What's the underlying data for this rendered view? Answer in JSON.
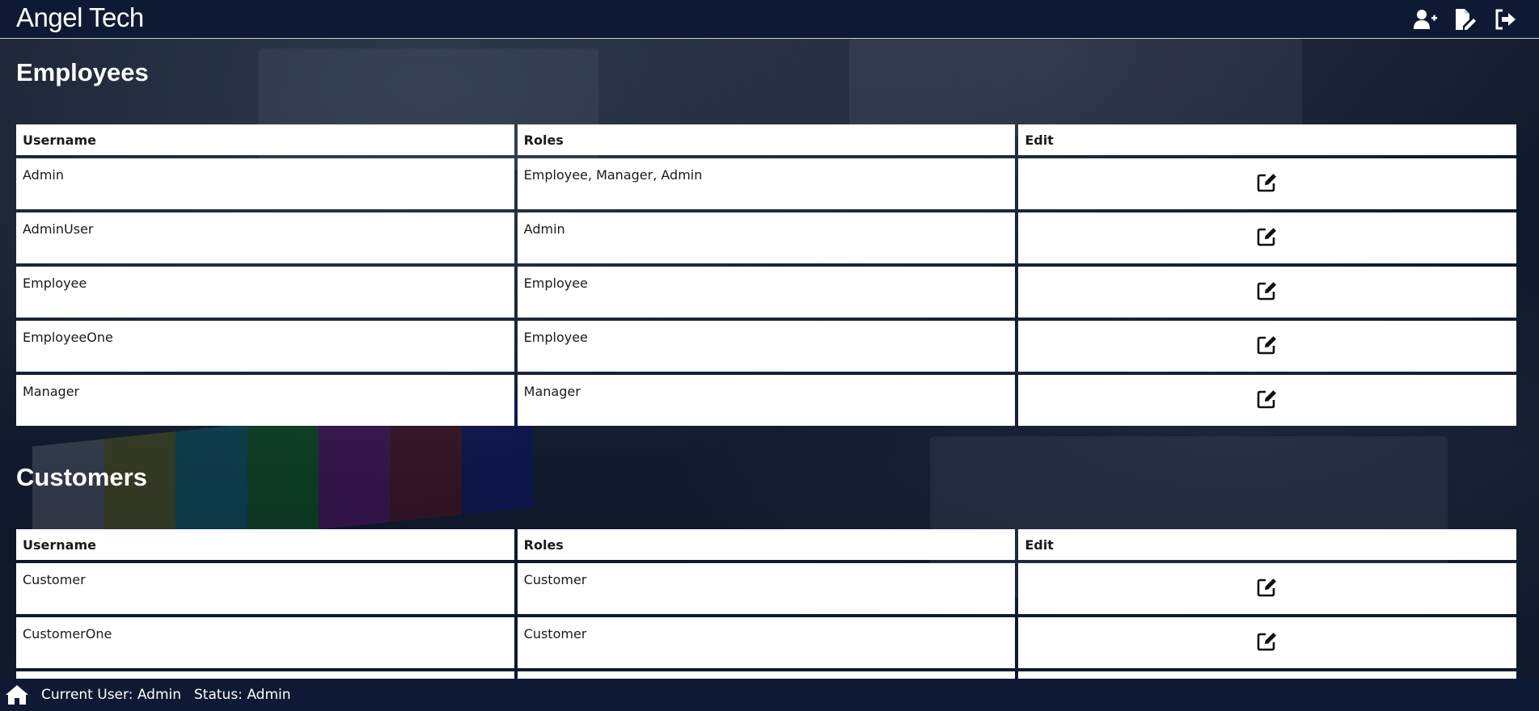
{
  "header": {
    "brand": "Angel Tech",
    "icons": [
      "add-user-icon",
      "edit-document-icon",
      "logout-icon"
    ]
  },
  "employees": {
    "title": "Employees",
    "columns": [
      "Username",
      "Roles",
      "Edit"
    ],
    "rows": [
      {
        "username": "Admin",
        "roles": "Employee, Manager, Admin"
      },
      {
        "username": "AdminUser",
        "roles": "Admin"
      },
      {
        "username": "Employee",
        "roles": "Employee"
      },
      {
        "username": "EmployeeOne",
        "roles": "Employee"
      },
      {
        "username": "Manager",
        "roles": "Manager"
      }
    ]
  },
  "customers": {
    "title": "Customers",
    "columns": [
      "Username",
      "Roles",
      "Edit"
    ],
    "rows": [
      {
        "username": "Customer",
        "roles": "Customer"
      },
      {
        "username": "CustomerOne",
        "roles": "Customer"
      },
      {
        "username": "",
        "roles": ""
      }
    ]
  },
  "footer": {
    "current_user": "Current User: Admin",
    "status": "Status: Admin"
  },
  "colors": {
    "header_bg": "#0e1a33",
    "cell_bg": "#ffffff",
    "text_dark": "#1a1a1a"
  }
}
